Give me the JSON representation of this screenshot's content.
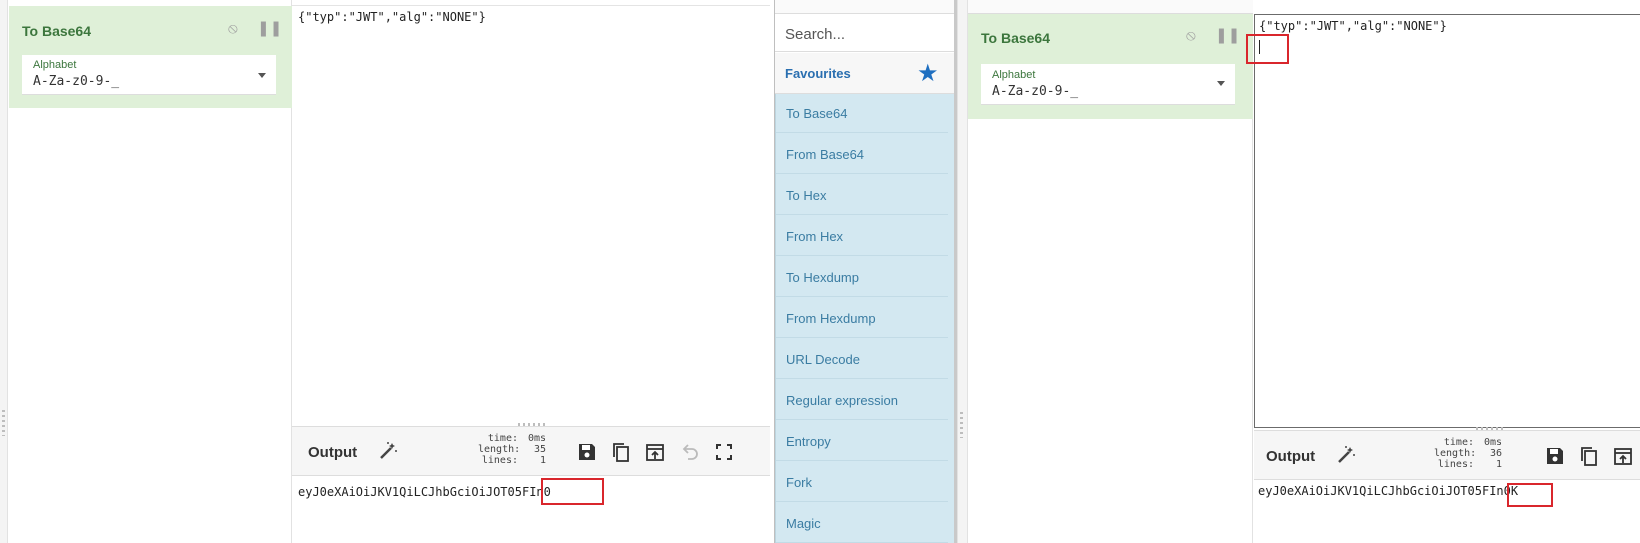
{
  "left": {
    "recipe": {
      "title": "To Base64",
      "alphabet_label": "Alphabet",
      "alphabet_value": "A-Za-z0-9-_"
    },
    "input_text": "{\"typ\":\"JWT\",\"alg\":\"NONE\"}",
    "output": {
      "title": "Output",
      "stats": [
        {
          "key": "time:",
          "value": "0ms"
        },
        {
          "key": "length:",
          "value": "35"
        },
        {
          "key": "lines:",
          "value": "1"
        }
      ],
      "text": "eyJ0eXAiOiJKV1QiLCJhbGciOiJOT05FIn0"
    }
  },
  "operations": {
    "search_placeholder": "Search...",
    "favourites_label": "Favourites",
    "items": [
      "To Base64",
      "From Base64",
      "To Hex",
      "From Hex",
      "To Hexdump",
      "From Hexdump",
      "URL Decode",
      "Regular expression",
      "Entropy",
      "Fork",
      "Magic"
    ]
  },
  "right": {
    "recipe": {
      "title": "To Base64",
      "alphabet_label": "Alphabet",
      "alphabet_value": "A-Za-z0-9-_"
    },
    "input_text": "{\"typ\":\"JWT\",\"alg\":\"NONE\"}",
    "output": {
      "title": "Output",
      "stats": [
        {
          "key": "time:",
          "value": "0ms"
        },
        {
          "key": "length:",
          "value": "36"
        },
        {
          "key": "lines:",
          "value": "1"
        }
      ],
      "text": "eyJ0eXAiOiJKV1QiLCJhbGciOiJOT05FIn0K"
    }
  },
  "colors": {
    "recipe_bg": "#dff0d8",
    "recipe_title": "#3c763d",
    "ops_bg": "#d3e8f1",
    "ops_text": "#3a7ca2",
    "favourites_star": "#1f6fc0",
    "highlight_box": "#d9262c"
  }
}
